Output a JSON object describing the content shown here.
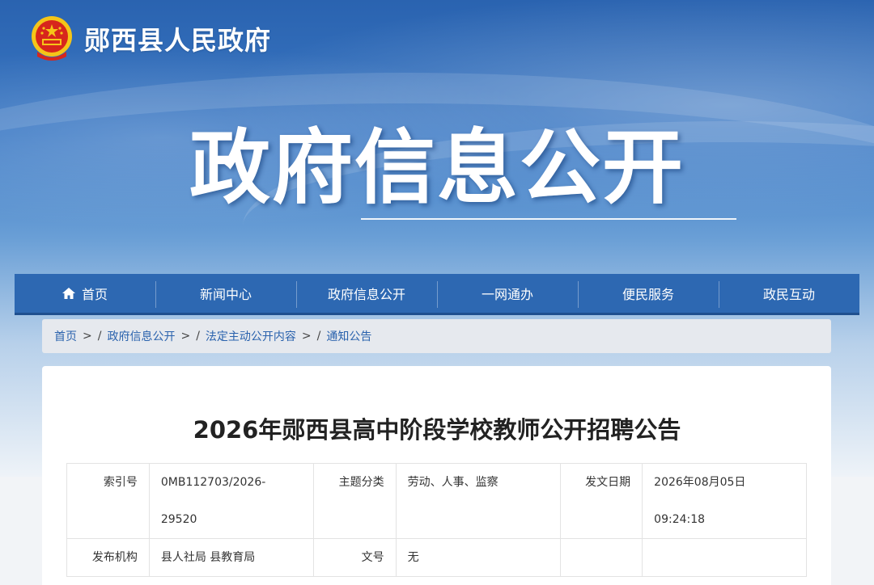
{
  "header": {
    "site_name": "郧西县人民政府",
    "banner_title": "政府信息公开"
  },
  "nav": {
    "items": [
      {
        "label": "首页",
        "icon": "home-icon"
      },
      {
        "label": "新闻中心"
      },
      {
        "label": "政府信息公开"
      },
      {
        "label": "一网通办"
      },
      {
        "label": "便民服务"
      },
      {
        "label": "政民互动"
      }
    ]
  },
  "breadcrumb": {
    "items": [
      "首页",
      "政府信息公开",
      "法定主动公开内容",
      "通知公告"
    ],
    "separator": ">"
  },
  "article": {
    "title": "2026年郧西县高中阶段学校教师公开招聘公告",
    "meta": {
      "index_label": "索引号",
      "index_value_line1": "0MB112703/2026-",
      "index_value_line2": "29520",
      "topic_label": "主题分类",
      "topic_value": "劳动、人事、监察",
      "date_label": "发文日期",
      "date_value_line1": "2026年08月05日",
      "date_value_line2": "09:24:18",
      "publisher_label": "发布机构",
      "publisher_value": "县人社局 县教育局",
      "docno_label": "文号",
      "docno_value": "无"
    }
  },
  "colors": {
    "nav_bg": "#2d68b2",
    "link": "#2a62ad",
    "emblem_red": "#d7261c",
    "emblem_gold": "#f5c518"
  }
}
